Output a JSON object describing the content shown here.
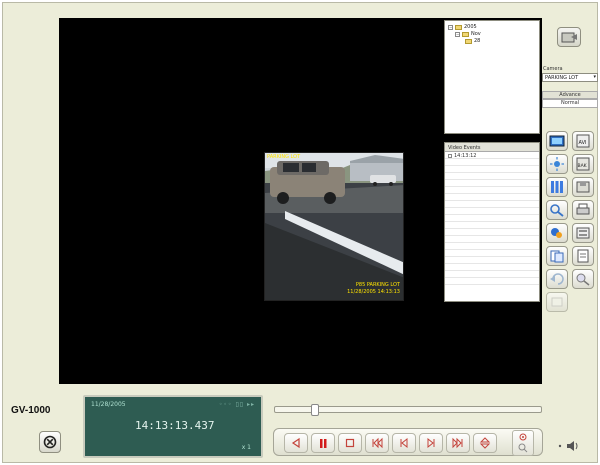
{
  "app": {
    "model": "GV-1000"
  },
  "video": {
    "overlay_title": "PARKING LOT",
    "overlay_camera": "P85 PARKING LOT",
    "overlay_timestamp": "11/28/2005 14:13:13"
  },
  "tree": {
    "year": "2005",
    "month": "Nov",
    "day": "28"
  },
  "events": {
    "header": "Video Events",
    "items": [
      "14:13:12"
    ]
  },
  "camera": {
    "label": "Camera",
    "selected": "PARKING LOT"
  },
  "tabs": {
    "advance": "Advance",
    "normal": "Normal"
  },
  "side_buttons": [
    "image-icon",
    "avi-export-icon",
    "brightness-icon",
    "backup-icon",
    "split-view-icon",
    "save-icon",
    "object-search-icon",
    "print-icon",
    "color-adjust-icon",
    "settings-icon",
    "copy-icon",
    "document-icon",
    "undo-icon",
    "zoom-fit-icon",
    "blank-icon"
  ],
  "lcd": {
    "date": "11/28/2005",
    "time": "14:13:13.437",
    "speed": "x 1",
    "status_icons": "◦◦◦ ▯▯ ▸▸"
  },
  "playback": {
    "seek_position": 0.14
  },
  "transport_buttons": [
    "reverse-play-icon",
    "pause-icon",
    "stop-icon",
    "rewind-icon",
    "previous-frame-icon",
    "next-frame-icon",
    "fast-forward-icon",
    "speed-icon"
  ],
  "colors": {
    "lcd": "#2e5c52",
    "panel": "#ecedd9",
    "pause": "#d21b1b"
  }
}
